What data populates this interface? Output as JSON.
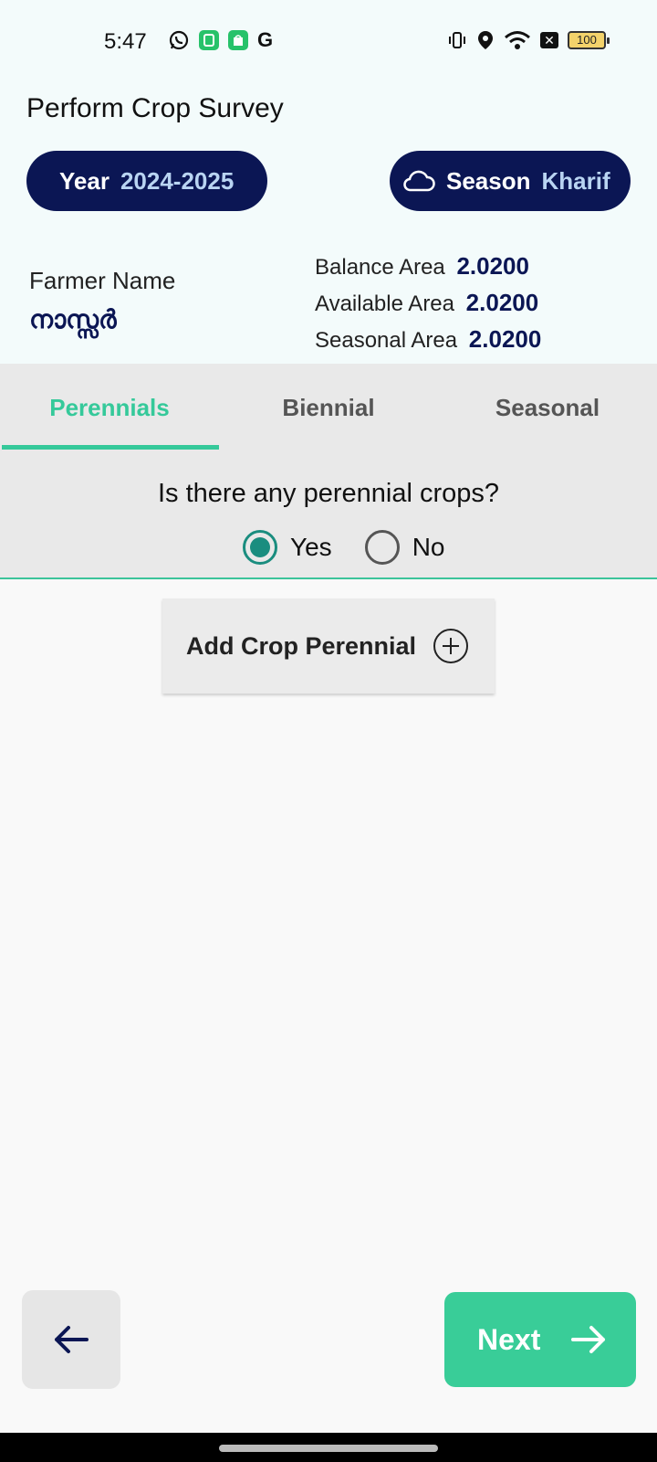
{
  "status_bar": {
    "time": "5:47",
    "battery": "100"
  },
  "header": {
    "title": "Perform Crop Survey",
    "year_label": "Year",
    "year_value": "2024-2025",
    "season_label": "Season",
    "season_value": "Kharif",
    "farmer_label": "Farmer Name",
    "farmer_name": "നാസ്സർ",
    "areas": {
      "balance_label": "Balance Area",
      "balance_value": "2.0200",
      "available_label": "Available Area",
      "available_value": "2.0200",
      "seasonal_label": "Seasonal Area",
      "seasonal_value": "2.0200"
    }
  },
  "tabs": [
    {
      "label": "Perennials",
      "active": true
    },
    {
      "label": "Biennial",
      "active": false
    },
    {
      "label": "Seasonal",
      "active": false
    }
  ],
  "question": {
    "text": "Is there any perennial crops?",
    "options": [
      {
        "label": "Yes",
        "selected": true
      },
      {
        "label": "No",
        "selected": false
      }
    ]
  },
  "add_button": {
    "label": "Add Crop Perennial"
  },
  "footer": {
    "next_label": "Next"
  },
  "colors": {
    "navy": "#0b1654",
    "accent_green": "#35c99a",
    "radio_teal": "#1a8d7f",
    "header_bg": "#f3fbfb"
  }
}
